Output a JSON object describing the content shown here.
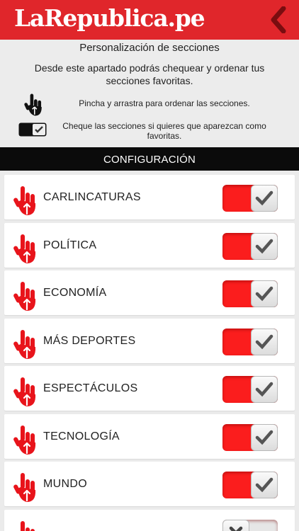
{
  "header": {
    "logo_text": "LaRepublica.pe",
    "back_icon": "chevron-left-icon",
    "brand_color": "#e0262b"
  },
  "intro": {
    "title": "Personalización de secciones",
    "description": "Desde este apartado podrás chequear y ordenar tus secciones favoritas.",
    "drag_hint": "Pincha y arrastra para ordenar las secciones.",
    "check_hint": "Cheque las secciones si quieres que aparezcan como favoritas."
  },
  "config": {
    "title": "CONFIGURACIÓN"
  },
  "sections": [
    {
      "label": "CARLINCATURAS",
      "enabled": true
    },
    {
      "label": "POLÍTICA",
      "enabled": true
    },
    {
      "label": "ECONOMÍA",
      "enabled": true
    },
    {
      "label": "MÁS DEPORTES",
      "enabled": true
    },
    {
      "label": "ESPECTÁCULOS",
      "enabled": true
    },
    {
      "label": "TECNOLOGÍA",
      "enabled": true
    },
    {
      "label": "MUNDO",
      "enabled": true
    },
    {
      "label": "",
      "enabled": false
    }
  ],
  "colors": {
    "toggle_on": "#fb1d1d",
    "hand_icon": "#e8141b"
  }
}
